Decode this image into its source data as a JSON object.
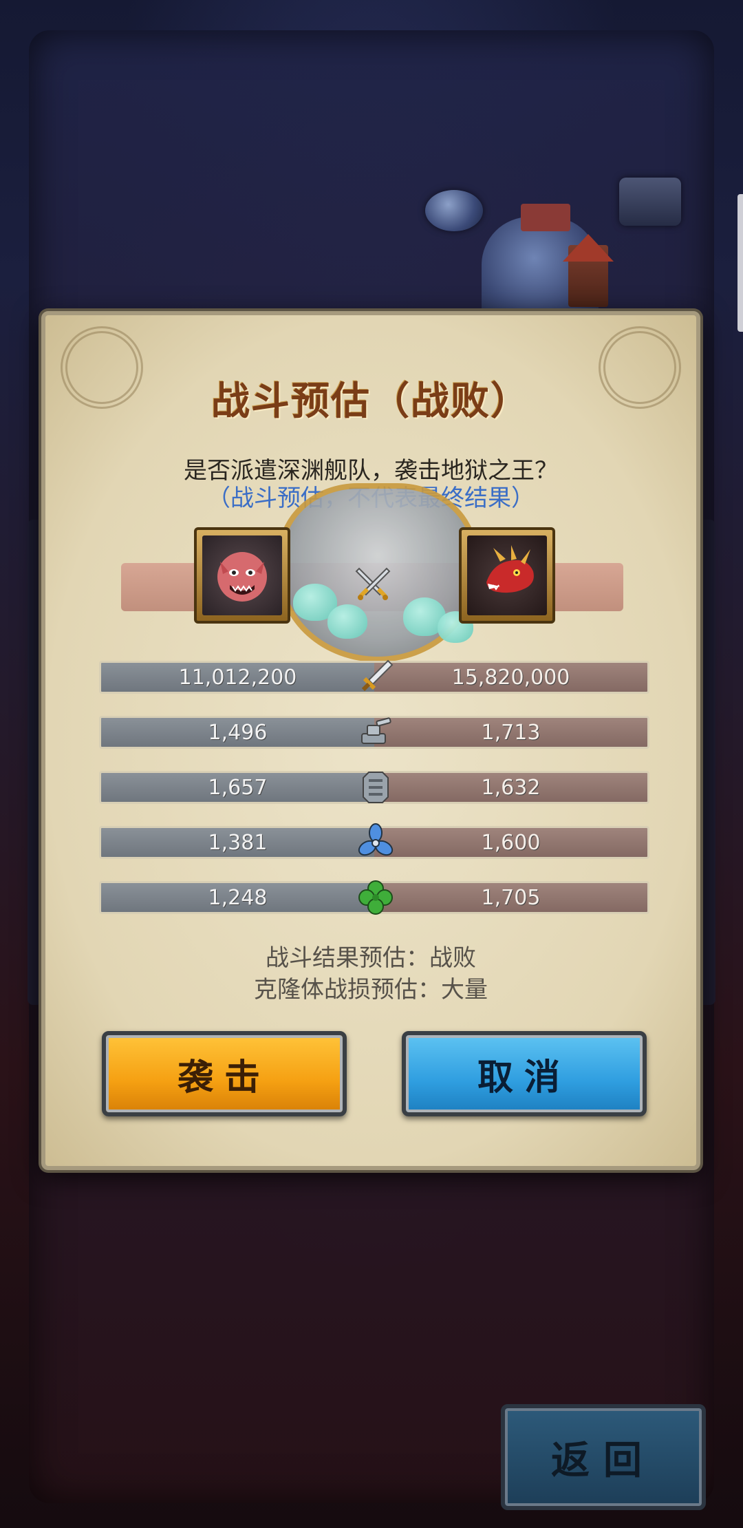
{
  "dialog": {
    "title": "战斗预估（战败）",
    "question": "是否派遣深渊舰队，袭击地狱之王？",
    "note": "（战斗预估，不代表最终结果）"
  },
  "stats": [
    {
      "icon": "sword-icon",
      "left": "11,012,200",
      "right": "15,820,000"
    },
    {
      "icon": "cannon-icon",
      "left": "1,496",
      "right": "1,713"
    },
    {
      "icon": "armor-plate-icon",
      "left": "1,657",
      "right": "1,632"
    },
    {
      "icon": "propeller-icon",
      "left": "1,381",
      "right": "1,600"
    },
    {
      "icon": "clover-icon",
      "left": "1,248",
      "right": "1,705"
    }
  ],
  "result": {
    "outcome": "战斗结果预估：战败",
    "losses": "克隆体战损预估：大量"
  },
  "buttons": {
    "attack": "袭击",
    "cancel": "取消",
    "back": "返回"
  },
  "colors": {
    "title": "#7a3d17",
    "note": "#3b6ec6",
    "attack_button": "#f5a012",
    "cancel_button": "#2f9ee0",
    "player_bar": "#7d848b",
    "enemy_bar": "#927670"
  }
}
